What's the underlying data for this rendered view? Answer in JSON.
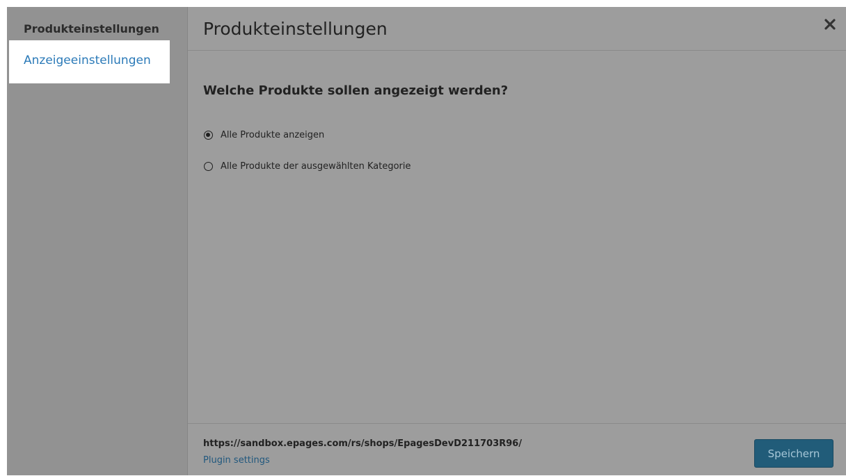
{
  "sidebar": {
    "title": "Produkteinstellungen",
    "items": [
      {
        "label": "Anzeigeeinstellungen"
      }
    ]
  },
  "header": {
    "title": "Produkteinstellungen",
    "close_icon": "close-icon"
  },
  "main": {
    "question": "Welche Produkte sollen angezeigt werden?",
    "options": [
      {
        "label": "Alle Produkte anzeigen",
        "selected": true
      },
      {
        "label": "Alle Produkte der ausgewählten Kategorie",
        "selected": false
      }
    ]
  },
  "footer": {
    "url": "https://sandbox.epages.com/rs/shops/EpagesDevD211703R96/",
    "link": "Plugin settings",
    "save_label": "Speichern"
  },
  "colors": {
    "accent": "#2b7ab8",
    "save_button": "#215c79",
    "overlay": "#9d9d9d"
  }
}
